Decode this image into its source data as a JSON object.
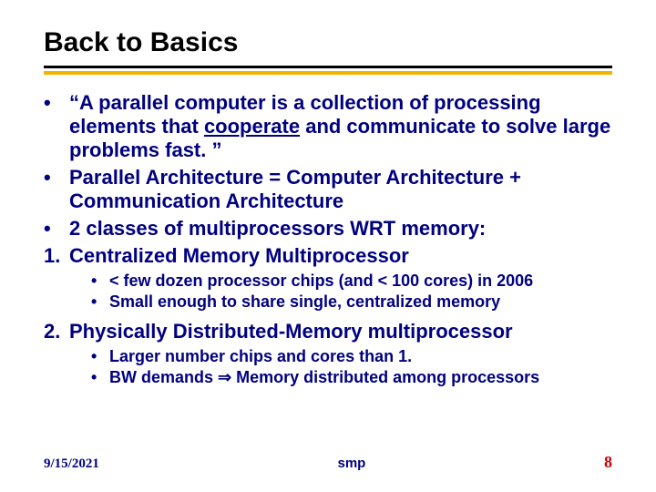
{
  "title": "Back to Basics",
  "bullets": {
    "b1_pre": "“A parallel computer is a collection of processing elements that ",
    "b1_u": "cooperate",
    "b1_post": " and communicate to solve large problems fast. ”",
    "b2": "Parallel Architecture = Computer Architecture + Communication Architecture",
    "b3": "2 classes of multiprocessors WRT memory:",
    "n1": "Centralized Memory Multiprocessor",
    "n1_sub1": "< few dozen processor chips (and < 100 cores) in 2006",
    "n1_sub2": "Small enough to share single, centralized memory",
    "n2": "Physically Distributed-Memory multiprocessor",
    "n2_sub1": "Larger number chips and cores than 1.",
    "n2_sub2": "BW demands ⇒ Memory distributed among processors"
  },
  "markers": {
    "dot": "•",
    "one": "1.",
    "two": "2."
  },
  "footer": {
    "date": "9/15/2021",
    "mid": "smp",
    "page": "8"
  }
}
